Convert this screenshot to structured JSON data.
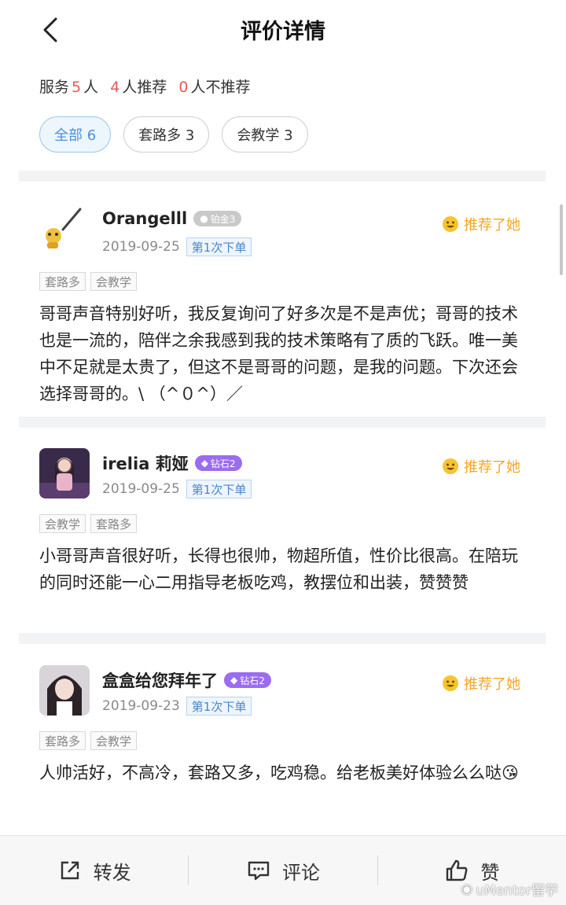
{
  "header": {
    "title": "评价详情"
  },
  "summary": {
    "prefix": "服务",
    "served_count": "5",
    "served_unit": "人",
    "recommend_count": "4",
    "recommend_label": "人推荐",
    "not_recommend_count": "0",
    "not_recommend_label": "人不推荐"
  },
  "filters": [
    {
      "label": "全部 6",
      "active": true
    },
    {
      "label": "套路多 3",
      "active": false
    },
    {
      "label": "会教学 3",
      "active": false
    }
  ],
  "reviews": [
    {
      "username": "Orangelll",
      "level": "铂金3",
      "date": "2019-09-25",
      "order": "第1次下单",
      "recommend": "推荐了她",
      "tags": [
        "套路多",
        "会教学"
      ],
      "content": "哥哥声音特别好听，我反复询问了好多次是不是声优；哥哥的技术也是一流的，陪伴之余我感到我的技术策略有了质的飞跃。唯一美中不足就是太贵了，但这不是哥哥的问题，是我的问题。下次还会选择哥哥的。\\ （^０^）／"
    },
    {
      "username": "irelia 莉娅",
      "level": "钻石2",
      "date": "2019-09-25",
      "order": "第1次下单",
      "recommend": "推荐了她",
      "tags": [
        "会教学",
        "套路多"
      ],
      "content": "小哥哥声音很好听，长得也很帅，物超所值，性价比很高。在陪玩的同时还能一心二用指导老板吃鸡，教摆位和出装，赞赞赞"
    },
    {
      "username": "盒盒给您拜年了",
      "level": "钻石2",
      "date": "2019-09-23",
      "order": "第1次下单",
      "recommend": "推荐了她",
      "tags": [
        "套路多",
        "会教学"
      ],
      "content": "人帅活好，不高冷，套路又多，吃鸡稳。给老板美好体验么么哒😘"
    }
  ],
  "bottom": {
    "share_label": "转发",
    "comment_label": "评论",
    "like_label": "赞"
  },
  "watermark": "uMentor留学",
  "colors": {
    "accent_red": "#e85a4f",
    "recommend_orange": "#f5a623",
    "diamond_purple": "#9b6cf0",
    "chip_active": "#4a90d9"
  }
}
